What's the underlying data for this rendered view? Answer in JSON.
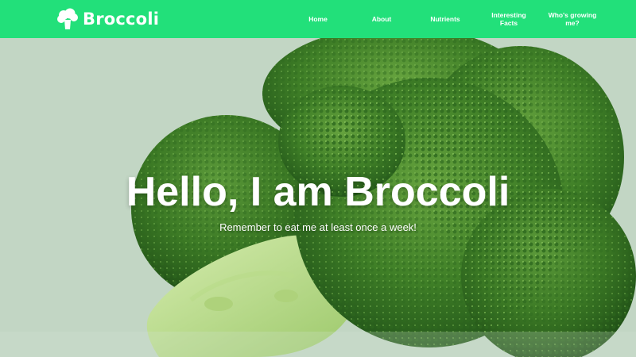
{
  "brand": {
    "name": "Broccoli",
    "icon": "broccoli-icon"
  },
  "nav": {
    "items": [
      {
        "label": "Home"
      },
      {
        "label": "About"
      },
      {
        "label": "Nutrients"
      },
      {
        "label": "Interesting\nFacts"
      },
      {
        "label": "Who's growing\nme?"
      }
    ]
  },
  "hero": {
    "title": "Hello, I am Broccoli",
    "subtitle": "Remember to eat me at least once a week!",
    "image": "broccoli-photo"
  },
  "colors": {
    "navbar": "#22e07a",
    "background": "#c2d6c4",
    "text": "#ffffff"
  }
}
